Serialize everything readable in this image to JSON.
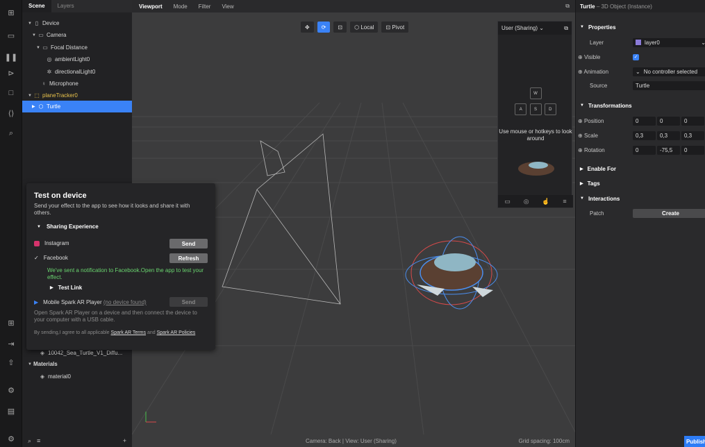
{
  "scene_panel": {
    "tabs": [
      "Scene",
      "Layers"
    ],
    "tree": [
      "Device",
      "Camera",
      "Focal Distance",
      "ambientLight0",
      "directionalLight0",
      "Microphone",
      "planeTracker0",
      "Turtle"
    ],
    "hidden_items": [
      "10042_Sea_Turtle_V1_Diffu...",
      "Materials",
      "material0"
    ],
    "bottom_plus": "+"
  },
  "viewport": {
    "tabs": [
      "Viewport",
      "Mode",
      "Filter",
      "View"
    ],
    "tools": [
      "Local",
      "Pivot"
    ],
    "status_camera": "Camera: Back | View: User (Sharing)",
    "status_grid": "Grid spacing: 100cm"
  },
  "preview": {
    "title": "User (Sharing)",
    "keys": [
      "W",
      "A",
      "S",
      "D"
    ],
    "message": "Use mouse or hotkeys to look around"
  },
  "dialog": {
    "title": "Test on device",
    "desc": "Send your effect to the app to see how it looks and share it with others.",
    "section": "Sharing Experience",
    "instagram": "Instagram",
    "send": "Send",
    "facebook": "Facebook",
    "refresh": "Refresh",
    "fb_note": "We've sent a notification to Facebook.Open the app to test your effect.",
    "test_link": "Test Link",
    "mobile": "Mobile Spark AR Player",
    "no_device": "(no device found)",
    "mobile_note": "Open Spark AR Player on a device and then connect the device to your computer with a USB cable.",
    "terms_prefix": "By sending,I agree to all applicable",
    "terms_link": "Spark AR Terms",
    "terms_and": "and",
    "policies_link": "Spark AR Policies"
  },
  "properties": {
    "object": "Turtle",
    "subtitle": "– 3D Object (Instance)",
    "sections": {
      "properties": "Properties",
      "transformations": "Transformations",
      "enable_for": "Enable For",
      "tags": "Tags",
      "interactions": "Interactions"
    },
    "labels": {
      "layer": "Layer",
      "visible": "Visible",
      "animation": "Animation",
      "source": "Source",
      "position": "Position",
      "scale": "Scale",
      "rotation": "Rotation",
      "patch": "Patch"
    },
    "values": {
      "layer": "layer0",
      "animation": "No controller selected",
      "source": "Turtle",
      "position": [
        "0",
        "0",
        "0"
      ],
      "scale": [
        "0,3",
        "0,3",
        "0,3"
      ],
      "rotation": [
        "0",
        "-75,5",
        "0"
      ]
    },
    "create": "Create",
    "publish": "Publish"
  }
}
